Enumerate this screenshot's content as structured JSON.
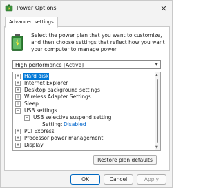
{
  "window": {
    "title": "Power Options",
    "tab_label": "Advanced settings"
  },
  "description": "Select the power plan that you want to customize, and then choose settings that reflect how you want your computer to manage power.",
  "plan_select": {
    "value": "High performance [Active]"
  },
  "tree": {
    "items": [
      {
        "label": "Hard disk",
        "expander": "+",
        "selected": true
      },
      {
        "label": "Internet Explorer",
        "expander": "+"
      },
      {
        "label": "Desktop background settings",
        "expander": "+"
      },
      {
        "label": "Wireless Adapter Settings",
        "expander": "+"
      },
      {
        "label": "Sleep",
        "expander": "+"
      },
      {
        "label": "USB settings",
        "expander": "−"
      },
      {
        "label": "USB selective suspend setting",
        "expander": "−"
      },
      {
        "label": "Setting:",
        "value": "Disabled"
      },
      {
        "label": "PCI Express",
        "expander": "+"
      },
      {
        "label": "Processor power management",
        "expander": "+"
      },
      {
        "label": "Display",
        "expander": "+"
      }
    ]
  },
  "buttons": {
    "restore": "Restore plan defaults",
    "ok": "OK",
    "cancel": "Cancel",
    "apply": "Apply"
  },
  "colors": {
    "selection": "#0078d7",
    "setting_value": "#0066cc"
  }
}
